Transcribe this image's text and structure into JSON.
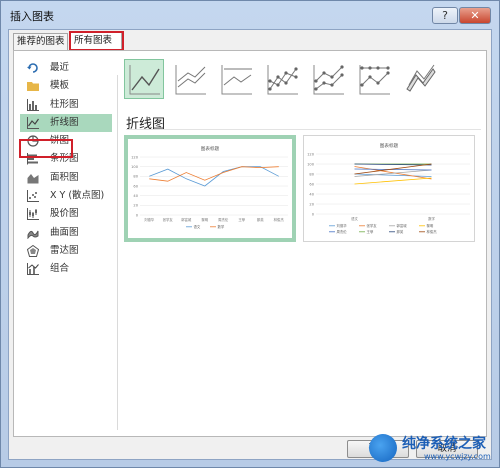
{
  "window": {
    "title": "插入图表",
    "help_label": "?",
    "close_label": "✕"
  },
  "tabs": [
    {
      "label": "推荐的图表",
      "selected": false
    },
    {
      "label": "所有图表",
      "selected": true
    }
  ],
  "sidebar": {
    "items": [
      {
        "label": "最近",
        "icon": "recent-icon"
      },
      {
        "label": "模板",
        "icon": "folder-icon"
      },
      {
        "label": "柱形图",
        "icon": "column-chart-icon"
      },
      {
        "label": "折线图",
        "icon": "line-chart-icon",
        "selected": true
      },
      {
        "label": "饼图",
        "icon": "pie-chart-icon"
      },
      {
        "label": "条形图",
        "icon": "bar-chart-icon"
      },
      {
        "label": "面积图",
        "icon": "area-chart-icon"
      },
      {
        "label": "X Y (散点图)",
        "icon": "scatter-chart-icon"
      },
      {
        "label": "股价图",
        "icon": "stock-chart-icon"
      },
      {
        "label": "曲面图",
        "icon": "surface-chart-icon"
      },
      {
        "label": "雷达图",
        "icon": "radar-chart-icon"
      },
      {
        "label": "组合",
        "icon": "combo-chart-icon"
      }
    ]
  },
  "subtypes": [
    {
      "icon": "line-icon",
      "selected": true
    },
    {
      "icon": "stacked-line-icon"
    },
    {
      "icon": "percent-stacked-line-icon"
    },
    {
      "icon": "line-markers-icon"
    },
    {
      "icon": "stacked-line-markers-icon"
    },
    {
      "icon": "percent-stacked-line-markers-icon"
    },
    {
      "icon": "3d-line-icon"
    }
  ],
  "section_heading": "折线图",
  "previews": [
    {
      "title": "图表标题",
      "y_ticks": [
        "120",
        "100",
        "80",
        "60",
        "40",
        "20",
        "0"
      ],
      "categories": [
        "刘德华",
        "张学友",
        "郭富城",
        "黎明",
        "周杰伦",
        "王菲",
        "那英",
        "林俊杰"
      ],
      "legend": [
        "语文",
        "数学"
      ]
    },
    {
      "title": "图表标题",
      "y_ticks": [
        "120",
        "100",
        "80",
        "60",
        "40",
        "20",
        "0"
      ],
      "categories": [
        "语文",
        "数学"
      ],
      "legend": [
        "刘德华",
        "张学友",
        "郭富城",
        "黎明",
        "周杰伦",
        "王菲",
        "那英",
        "林俊杰"
      ]
    }
  ],
  "chart_data": [
    {
      "type": "line",
      "title": "图表标题",
      "categories": [
        "刘德华",
        "张学友",
        "郭富城",
        "黎明",
        "周杰伦",
        "王菲",
        "那英",
        "林俊杰"
      ],
      "ylim": [
        0,
        120
      ],
      "series": [
        {
          "name": "语文",
          "values": [
            80,
            95,
            75,
            60,
            90,
            100,
            100,
            80
          ]
        },
        {
          "name": "数学",
          "values": [
            75,
            70,
            88,
            72,
            88,
            100,
            98,
            100
          ]
        }
      ],
      "colors": [
        "#5b9bd5",
        "#ed7d31"
      ],
      "legend": "bottom",
      "grid": true
    },
    {
      "type": "line",
      "title": "图表标题",
      "categories": [
        "语文",
        "数学"
      ],
      "ylim": [
        0,
        120
      ],
      "series": [
        {
          "name": "刘德华",
          "values": [
            80,
            75
          ]
        },
        {
          "name": "张学友",
          "values": [
            95,
            70
          ]
        },
        {
          "name": "郭富城",
          "values": [
            75,
            88
          ]
        },
        {
          "name": "黎明",
          "values": [
            60,
            72
          ]
        },
        {
          "name": "周杰伦",
          "values": [
            90,
            88
          ]
        },
        {
          "name": "王菲",
          "values": [
            100,
            100
          ]
        },
        {
          "name": "那英",
          "values": [
            100,
            98
          ]
        },
        {
          "name": "林俊杰",
          "values": [
            80,
            100
          ]
        }
      ],
      "colors": [
        "#5b9bd5",
        "#ed7d31",
        "#a5a5a5",
        "#ffc000",
        "#4472c4",
        "#70ad47",
        "#264478",
        "#9e480e"
      ],
      "legend": "bottom",
      "grid": true
    }
  ],
  "footer": {
    "ok_label": "确定",
    "cancel_label": "取消"
  },
  "watermark": {
    "title": "纯净系统之家",
    "url": "www.ycwjzy.com"
  }
}
